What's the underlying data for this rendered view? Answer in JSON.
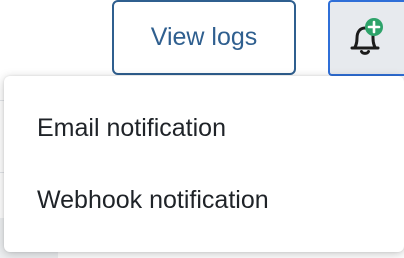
{
  "toolbar": {
    "view_logs_label": "View logs",
    "add_notification_icon": "bell-plus-icon"
  },
  "dropdown": {
    "items": [
      {
        "label": "Email notification"
      },
      {
        "label": "Webhook notification"
      }
    ]
  },
  "colors": {
    "accent": "#2f5f8f",
    "focus_border": "#2f6fd8",
    "badge_green": "#2ea36a",
    "text": "#1f2328"
  }
}
